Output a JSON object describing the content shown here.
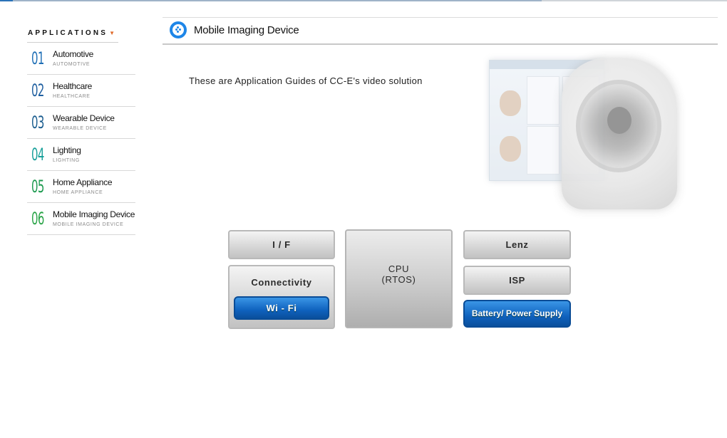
{
  "sidebar": {
    "title": "APPLICATIONS",
    "items": [
      {
        "num": "01",
        "name": "Automotive",
        "sub": "AUTOMOTIVE",
        "color": "#1f6fb6"
      },
      {
        "num": "02",
        "name": "Healthcare",
        "sub": "HEALTHCARE",
        "color": "#1f5fa0"
      },
      {
        "num": "03",
        "name": "Wearable Device",
        "sub": "WEARABLE DEVICE",
        "color": "#1b5d8f"
      },
      {
        "num": "04",
        "name": "Lighting",
        "sub": "LIGHTING",
        "color": "#18a09a"
      },
      {
        "num": "05",
        "name": "Home Appliance",
        "sub": "HOME APPLIANCE",
        "color": "#1c9a4f"
      },
      {
        "num": "06",
        "name": "Mobile Imaging Device",
        "sub": "MOBILE IMAGING DEVICE",
        "color": "#2aa448"
      }
    ]
  },
  "header": {
    "title": "Mobile Imaging Device",
    "icon": "device-icon"
  },
  "intro": "These are Application Guides of CC-E's video solution",
  "blocks": {
    "if": "I / F",
    "connectivity": "Connectivity",
    "wifi": "Wi - Fi",
    "cpu_line1": "CPU",
    "cpu_line2": "(RTOS)",
    "lenz": "Lenz",
    "isp": "ISP",
    "battery": "Battery/ Power Supply"
  },
  "colors": {
    "accent_blue": "#1e86e8",
    "block_blue": "#0f62be",
    "arrow_orange": "#e06a2a"
  }
}
